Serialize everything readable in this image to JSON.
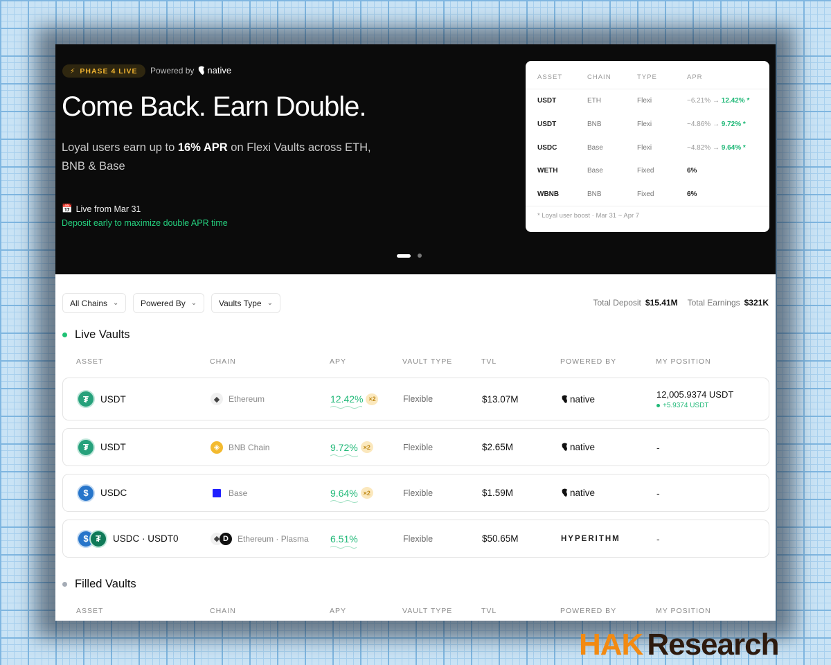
{
  "hero": {
    "phase_badge": "PHASE 4 LIVE",
    "powered_by_label": "Powered by",
    "powered_by_brand": "native",
    "title": "Come Back. Earn Double.",
    "subtitle_pre": "Loyal users earn up to ",
    "subtitle_bold": "16% APR",
    "subtitle_post": " on Flexi Vaults across ETH, BNB & Base",
    "live_from": "Live from Mar 31",
    "deposit_note": "Deposit early to maximize double APR time",
    "carousel_active_index": 1,
    "carousel_count": 2
  },
  "apr_card": {
    "headers": {
      "asset": "ASSET",
      "chain": "CHAIN",
      "type": "TYPE",
      "apr": "APR"
    },
    "rows": [
      {
        "asset": "USDT",
        "chain": "ETH",
        "type": "Flexi",
        "apr_old": "~6.21% →",
        "apr_new": "12.42%",
        "mark": "*"
      },
      {
        "asset": "USDT",
        "chain": "BNB",
        "type": "Flexi",
        "apr_old": "~4.86% →",
        "apr_new": "9.72%",
        "mark": "*"
      },
      {
        "asset": "USDC",
        "chain": "Base",
        "type": "Flexi",
        "apr_old": "~4.82% →",
        "apr_new": "9.64%",
        "mark": "*"
      },
      {
        "asset": "WETH",
        "chain": "Base",
        "type": "Fixed",
        "apr_fixed": "6%"
      },
      {
        "asset": "WBNB",
        "chain": "BNB",
        "type": "Fixed",
        "apr_fixed": "6%"
      }
    ],
    "footnote": "* Loyal user boost · Mar 31 ~ Apr 7"
  },
  "filters": {
    "chains": "All Chains",
    "powered_by": "Powered By",
    "vault_type": "Vaults Type"
  },
  "totals": {
    "deposit_label": "Total Deposit",
    "deposit_value": "$15.41M",
    "earnings_label": "Total Earnings",
    "earnings_value": "$321K"
  },
  "live_vaults": {
    "title": "Live Vaults",
    "headers": {
      "asset": "ASSET",
      "chain": "CHAIN",
      "apy": "APY",
      "type": "VAULT TYPE",
      "tvl": "TVL",
      "powered": "POWERED BY",
      "position": "MY POSITION"
    },
    "rows": [
      {
        "asset": "USDT",
        "chain": "Ethereum",
        "apy": "12.42%",
        "boost": "×2",
        "type": "Flexible",
        "tvl": "$13.07M",
        "powered": "native",
        "position": "12,005.9374 USDT",
        "position_delta": "+5.9374 USDT"
      },
      {
        "asset": "USDT",
        "chain": "BNB Chain",
        "apy": "9.72%",
        "boost": "×2",
        "type": "Flexible",
        "tvl": "$2.65M",
        "powered": "native",
        "position": "-"
      },
      {
        "asset": "USDC",
        "chain": "Base",
        "apy": "9.64%",
        "boost": "×2",
        "type": "Flexible",
        "tvl": "$1.59M",
        "powered": "native",
        "position": "-"
      },
      {
        "asset": "USDC · USDT0",
        "chain": "Ethereum · Plasma",
        "apy": "6.51%",
        "type": "Flexible",
        "tvl": "$50.65M",
        "powered": "HYPERITHM",
        "position": "-"
      }
    ]
  },
  "filled_vaults": {
    "title": "Filled Vaults",
    "headers": {
      "asset": "ASSET",
      "chain": "CHAIN",
      "apy": "APY",
      "type": "VAULT TYPE",
      "tvl": "TVL",
      "powered": "POWERED BY",
      "position": "MY POSITION"
    }
  },
  "watermark": {
    "part1": "HAK",
    "part2": "Research"
  },
  "icons": {
    "bolt": "lightning-icon",
    "calendar": "calendar-icon",
    "chevron": "chevron-down-icon",
    "usdt": "tether-icon",
    "usdc": "usd-coin-icon",
    "eth": "ethereum-icon",
    "bnb": "bnb-icon",
    "base": "base-icon",
    "plasma": "plasma-icon"
  },
  "colors": {
    "accent_green": "#1fb877",
    "badge_gold": "#f2b530",
    "hero_bg": "#0b0b0b",
    "watermark_orange": "#f28a12"
  }
}
